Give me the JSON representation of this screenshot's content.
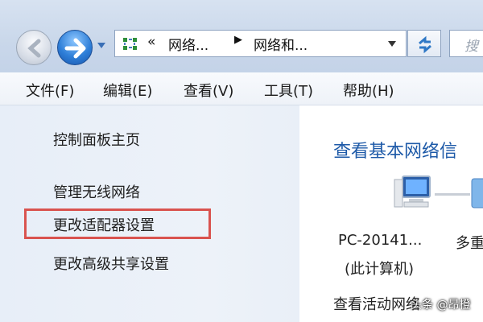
{
  "address_bar": {
    "overflow_marker": "«",
    "crumb1": "网络...",
    "crumb2": "网络和..."
  },
  "search": {
    "placeholder": "搜"
  },
  "menubar": {
    "items": [
      "文件(F)",
      "编辑(E)",
      "查看(V)",
      "工具(T)",
      "帮助(H)"
    ]
  },
  "left_pane": {
    "home": "控制面板主页",
    "wireless": "管理无线网络",
    "adapter": "更改适配器设置",
    "sharing": "更改高级共享设置"
  },
  "right_pane": {
    "title": "查看基本网络信",
    "computer_name": "PC-20141...",
    "computer_sub": "(此计算机)",
    "multiple": "多重",
    "active_networks": "查看活动网络"
  },
  "watermark": "头条 @昂橙",
  "colors": {
    "highlight": "#d9534f",
    "title_blue": "#1e5aa8"
  }
}
